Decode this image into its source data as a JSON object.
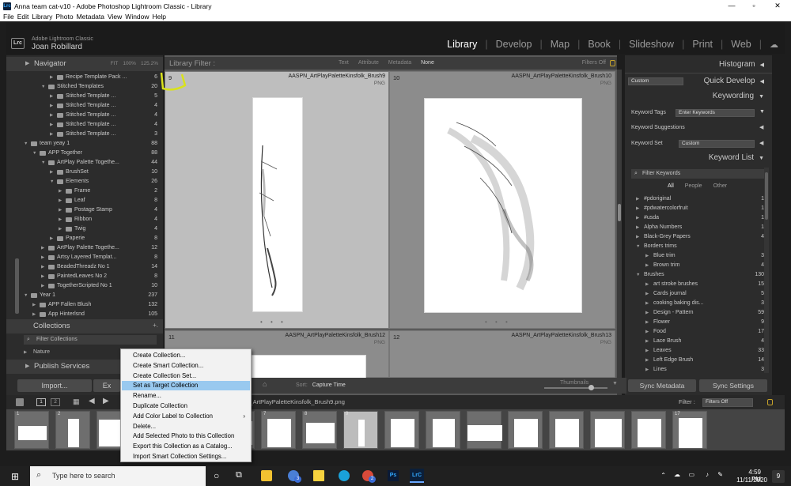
{
  "window": {
    "app_badge": "Lrc",
    "title": "Anna team cat-v10 - Adobe Photoshop Lightroom Classic - Library",
    "minimize": "—",
    "maximize": "▫",
    "close": "✕"
  },
  "menubar": [
    "File",
    "Edit",
    "Library",
    "Photo",
    "Metadata",
    "View",
    "Window",
    "Help"
  ],
  "identity": {
    "logo": "Lrc",
    "product": "Adobe Lightroom Classic",
    "user": "Joan Robillard"
  },
  "modules": [
    "Library",
    "Develop",
    "Map",
    "Book",
    "Slideshow",
    "Print",
    "Web"
  ],
  "active_module": "Library",
  "left_panel": {
    "navigator": {
      "title": "Navigator",
      "fit": "FIT",
      "z1": "100%",
      "z2": "125.2%"
    },
    "tree": [
      {
        "label": "Recipe Template Pack ...",
        "count": "6",
        "indent": 4,
        "type": "folder"
      },
      {
        "label": "Stitched Templates",
        "count": "20",
        "indent": 3,
        "type": "folder",
        "expanded": true
      },
      {
        "label": "Stitched Template ...",
        "count": "5",
        "indent": 4,
        "type": "folder"
      },
      {
        "label": "Stitched Template ...",
        "count": "4",
        "indent": 4,
        "type": "folder"
      },
      {
        "label": "Stitched Template ...",
        "count": "4",
        "indent": 4,
        "type": "folder"
      },
      {
        "label": "Stitched Template ...",
        "count": "4",
        "indent": 4,
        "type": "folder"
      },
      {
        "label": "Stitched Template ...",
        "count": "3",
        "indent": 4,
        "type": "folder"
      },
      {
        "label": "team yeay 1",
        "count": "88",
        "indent": 1,
        "type": "set",
        "expanded": true
      },
      {
        "label": "APP Together",
        "count": "88",
        "indent": 2,
        "type": "folder",
        "expanded": true
      },
      {
        "label": "ArtPlay Palette Togethe...",
        "count": "44",
        "indent": 3,
        "type": "folder",
        "expanded": true
      },
      {
        "label": "BrushSet",
        "count": "10",
        "indent": 4,
        "type": "folder"
      },
      {
        "label": "Elements",
        "count": "26",
        "indent": 4,
        "type": "folder",
        "expanded": true
      },
      {
        "label": "Frame",
        "count": "2",
        "indent": 5,
        "type": "folder"
      },
      {
        "label": "Leaf",
        "count": "8",
        "indent": 5,
        "type": "folder"
      },
      {
        "label": "Postage Stamp",
        "count": "4",
        "indent": 5,
        "type": "folder"
      },
      {
        "label": "Ribbon",
        "count": "4",
        "indent": 5,
        "type": "folder"
      },
      {
        "label": "Twig",
        "count": "4",
        "indent": 5,
        "type": "folder"
      },
      {
        "label": "Paperie",
        "count": "8",
        "indent": 4,
        "type": "folder"
      },
      {
        "label": "ArtPlay Palette Togethe...",
        "count": "12",
        "indent": 3,
        "type": "folder"
      },
      {
        "label": "Artsy Layered Templat...",
        "count": "8",
        "indent": 3,
        "type": "folder"
      },
      {
        "label": "BeadedThreadz No 1",
        "count": "14",
        "indent": 3,
        "type": "folder"
      },
      {
        "label": "PaintedLeaves No 2",
        "count": "8",
        "indent": 3,
        "type": "folder"
      },
      {
        "label": "TogetherScripted No 1",
        "count": "10",
        "indent": 3,
        "type": "folder"
      },
      {
        "label": "Year 1",
        "count": "237",
        "indent": 1,
        "type": "set",
        "expanded": true
      },
      {
        "label": "APP Fallen Blush",
        "count": "132",
        "indent": 2,
        "type": "folder"
      },
      {
        "label": "App Hinterlsnd",
        "count": "105",
        "indent": 2,
        "type": "folder"
      }
    ],
    "collections": {
      "title": "Collections",
      "add": "+.",
      "filter_label": "Filter Collections",
      "nature": "Nature"
    },
    "publish": {
      "title": "Publish Services",
      "add": "+."
    }
  },
  "library_filter": {
    "title": "Library Filter :",
    "options": [
      "Text",
      "Attribute",
      "Metadata",
      "None"
    ],
    "selected": "None",
    "status": "Filters Off"
  },
  "grid": [
    {
      "num": "9",
      "name": "AASPN_ArtPlayPaletteKinsfolk_Brush9",
      "ext": "PNG",
      "selected": true
    },
    {
      "num": "10",
      "name": "AASPN_ArtPlayPaletteKinsfolk_Brush10",
      "ext": "PNG",
      "selected": false
    },
    {
      "num": "11",
      "name": "AASPN_ArtPlayPaletteKinsfolk_Brush12",
      "ext": "PNG",
      "selected": false
    },
    {
      "num": "12",
      "name": "AASPN_ArtPlayPaletteKinsfolk_Brush13",
      "ext": "PNG",
      "selected": false
    }
  ],
  "toolbar": {
    "sort_label": "Sort:",
    "sort_value": "Capture Time",
    "thumbs_label": "Thumbnails"
  },
  "right_panel": {
    "histogram": "Histogram",
    "quick_develop": "Quick Develop",
    "qd_preset": "Custom",
    "keywording": "Keywording",
    "keyword_tags_label": "Keyword Tags",
    "keyword_tags_value": "Enter Keywords",
    "keyword_suggestions": "Keyword Suggestions",
    "keyword_set_label": "Keyword Set",
    "keyword_set_value": "Custom",
    "keyword_list": "Keyword List",
    "filter_keywords": "Filter Keywords",
    "kw_tabs": [
      "All",
      "People",
      "Other"
    ],
    "keywords": [
      {
        "label": "#pdoriginal",
        "count": "1",
        "indent": 0
      },
      {
        "label": "#pdwatercolorfruit",
        "count": "1",
        "indent": 0
      },
      {
        "label": "#usda",
        "count": "1",
        "indent": 0
      },
      {
        "label": "Alpha Numbers",
        "count": "1",
        "indent": 0
      },
      {
        "label": "Black-Grey Papers",
        "count": "4",
        "indent": 0
      },
      {
        "label": "Borders trims",
        "count": "",
        "indent": 0,
        "expanded": true
      },
      {
        "label": "Blue trim",
        "count": "3",
        "indent": 1
      },
      {
        "label": "Brown trim",
        "count": "4",
        "indent": 1
      },
      {
        "label": "Brushes",
        "count": "130",
        "indent": 0,
        "expanded": true
      },
      {
        "label": "art stroke brushes",
        "count": "15",
        "indent": 1
      },
      {
        "label": "Cards journal",
        "count": "5",
        "indent": 1
      },
      {
        "label": "cooking baking dis...",
        "count": "3",
        "indent": 1
      },
      {
        "label": "Design - Pattern",
        "count": "59",
        "indent": 1
      },
      {
        "label": "Flower",
        "count": "9",
        "indent": 1
      },
      {
        "label": "Food",
        "count": "17",
        "indent": 1
      },
      {
        "label": "Lace Brush",
        "count": "4",
        "indent": 1
      },
      {
        "label": "Leaves",
        "count": "33",
        "indent": 1
      },
      {
        "label": "Left Edge Brush",
        "count": "14",
        "indent": 1
      },
      {
        "label": "Lines",
        "count": "3",
        "indent": 1
      }
    ],
    "sync_metadata": "Sync Metadata",
    "sync_settings": "Sync Settings"
  },
  "bottom": {
    "import": "Import...",
    "export": "Ex"
  },
  "filmstrip": {
    "breadcrumb": "N_ArtPlayPaletteKinsfolk_Brush9.png",
    "pages": [
      "1",
      "2"
    ],
    "filter_label": "Filter :",
    "filter_value": "Filters Off",
    "cells": [
      "1",
      "2",
      "",
      "",
      "",
      "",
      "7",
      "8",
      "9",
      "",
      "",
      "",
      "",
      "",
      "",
      "",
      "17"
    ]
  },
  "context_menu": {
    "items": [
      "Create Collection...",
      "Create Smart Collection...",
      "Create Collection Set...",
      "Set as Target Collection",
      "Rename...",
      "Duplicate Collection",
      "Add Color Label to Collection",
      "Delete...",
      "Add Selected Photo to this Collection",
      "Export this Collection as a Catalog...",
      "Import Smart Collection Settings..."
    ],
    "highlighted": 3,
    "submenu_index": 6
  },
  "taskbar": {
    "search_placeholder": "Type here to search",
    "badges": {
      "explorer": "3",
      "chrome": "2"
    },
    "time": "4:59 PM",
    "date": "11/11/2020",
    "notif": "9"
  }
}
